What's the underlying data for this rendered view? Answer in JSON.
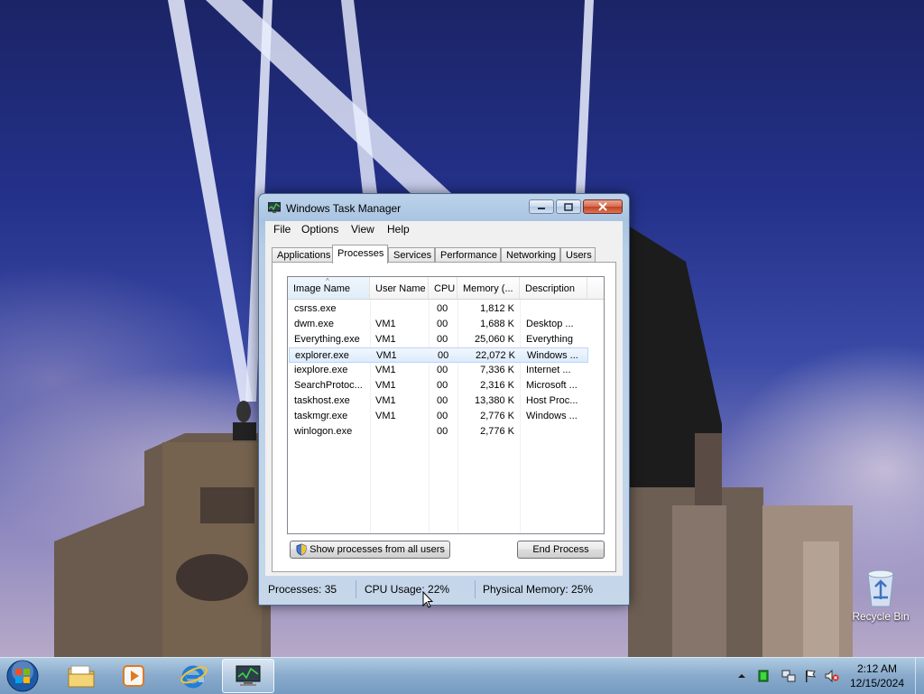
{
  "desktop": {
    "recycle_bin_label": "Recycle Bin"
  },
  "window": {
    "title": "Windows Task Manager",
    "menu": [
      "File",
      "Options",
      "View",
      "Help"
    ],
    "tabs": [
      "Applications",
      "Processes",
      "Services",
      "Performance",
      "Networking",
      "Users"
    ],
    "active_tab": "Processes",
    "columns": [
      "Image Name",
      "User Name",
      "CPU",
      "Memory (...",
      "Description"
    ],
    "processes": [
      {
        "name": "csrss.exe",
        "user": "",
        "cpu": "00",
        "memory": "1,812 K",
        "description": ""
      },
      {
        "name": "dwm.exe",
        "user": "VM1",
        "cpu": "00",
        "memory": "1,688 K",
        "description": "Desktop ..."
      },
      {
        "name": "Everything.exe",
        "user": "VM1",
        "cpu": "00",
        "memory": "25,060 K",
        "description": "Everything"
      },
      {
        "name": "explorer.exe",
        "user": "VM1",
        "cpu": "00",
        "memory": "22,072 K",
        "description": "Windows ..."
      },
      {
        "name": "iexplore.exe",
        "user": "VM1",
        "cpu": "00",
        "memory": "7,336 K",
        "description": "Internet ..."
      },
      {
        "name": "SearchProtoc...",
        "user": "VM1",
        "cpu": "00",
        "memory": "2,316 K",
        "description": "Microsoft ..."
      },
      {
        "name": "taskhost.exe",
        "user": "VM1",
        "cpu": "00",
        "memory": "13,380 K",
        "description": "Host Proc..."
      },
      {
        "name": "taskmgr.exe",
        "user": "VM1",
        "cpu": "00",
        "memory": "2,776 K",
        "description": "Windows ..."
      },
      {
        "name": "winlogon.exe",
        "user": "",
        "cpu": "00",
        "memory": "2,776 K",
        "description": ""
      }
    ],
    "selected_process": "explorer.exe",
    "show_all_users_label": "Show processes from all users",
    "end_process_label": "End Process",
    "status": {
      "processes": "Processes: 35",
      "cpu_usage": "CPU Usage: 22%",
      "physical_memory": "Physical Memory: 25%"
    }
  },
  "taskbar": {
    "pinned": [
      "start-orb",
      "explorer-icon",
      "media-player-icon",
      "internet-explorer-icon",
      "task-manager-icon"
    ],
    "clock_time": "2:12 AM",
    "clock_date": "12/15/2024"
  },
  "colors": {
    "titlebar": "#b7cde6",
    "close_button": "#c3411f",
    "selection": "#dcebfc",
    "taskbar": "#82a5c8"
  }
}
